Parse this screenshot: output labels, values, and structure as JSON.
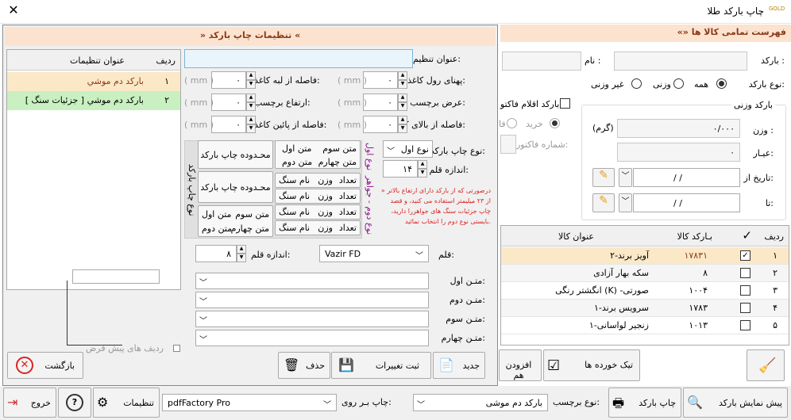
{
  "window": {
    "title": "چاپ بارکد طلا",
    "close": "✕",
    "logo": "GOLD"
  },
  "main": {
    "header": "«» فهرست تمامی کالا ها",
    "barcode_label": "بارکد :",
    "name_label": "نام :",
    "type_label": "نوع بارکد:",
    "types": [
      "همه",
      "وزنی",
      "غیر وزنی"
    ],
    "weight_group": "بارکد وزنی",
    "weight_label": "وزن :",
    "weight_value": "۰/۰۰۰",
    "weight_unit": "(گرم)",
    "ayar_label": "عیـار:",
    "ayar_value": "۰",
    "date_from": "تاریخ از:",
    "date_to": "تا:",
    "date_value": "/   /",
    "factor_check": "بارکد اقلام فاکتو",
    "factor_buy": "خرید",
    "factor_no": "شماره فاکتور:",
    "factor_fa": "فا",
    "grid_headers": {
      "row": "ردیف",
      "check": "✓",
      "barcode": "بـارکد کالا",
      "title": "عنوان کالا"
    },
    "rows": [
      {
        "n": "۱",
        "barcode": "۱۷۸۳۱",
        "title": "آویز برند-۲",
        "checked": "✓"
      },
      {
        "n": "۲",
        "barcode": "۸",
        "title": "سکه بهار آزادی",
        "checked": ""
      },
      {
        "n": "۳",
        "barcode": "۱۰۰۴",
        "title": "انگشتر رنگی (K) -صورتی",
        "checked": ""
      },
      {
        "n": "۴",
        "barcode": "۱۷۸۳",
        "title": "سرویس برند-۱",
        "checked": ""
      },
      {
        "n": "۵",
        "barcode": "۱۰۱۳",
        "title": "زنجیر لواسانی-۱",
        "checked": ""
      }
    ],
    "btn_damaged": "تیک خورده ها",
    "btn_add": "افزودن هم"
  },
  "dialog": {
    "title": "»  تنظیمات چاپ بارکد  «",
    "list_headers": {
      "row": "ردیف",
      "title": "عنوان تنظیمات"
    },
    "list": [
      {
        "n": "۱",
        "title": "بارکد دم موشي"
      },
      {
        "n": "۲",
        "title": "بارکد دم موشي [ جزئیات سنگ ]"
      }
    ],
    "setting_title_label": "عنوان تنظیم:",
    "roll_width": "پهنای رول کاغذ:",
    "label_width": "عرض برچسب:",
    "top_margin": "فاصله از بالای کاغذ:",
    "edge_margin": "فاصله از لبه کاغذ:",
    "label_height": "ارتفاع برچسب:",
    "bottom_margin": "فاصله از پائین کاغذ:",
    "zero": "۰",
    "mm": "( mm )",
    "print_type_label": "نوع چاپ بارکد:",
    "print_type_value": "نوع اول",
    "pen_size_label": "اندازه قلم بارکد:",
    "pen_size_value": "۱۴",
    "note": "» درصورتی که از بارکد دارای ارتفاع بالاتر از ۲۳ میلیمتر استفاده می کنید، و قصد چاپ جزئیات سنگ های جواهررا دارید، بایستی نوع دوم را انتخاب نمائید.",
    "type1_v": "نوع اول",
    "type2_v": "نوع دوم - جواهر",
    "print_type_v": "نوع چاپ بارکد",
    "txt3": "متن سوم",
    "txt1": "متن اول",
    "txt4": "متن چهارم",
    "txt2": "متن دوم",
    "area": "محـدوده چاپ بارکد",
    "count": "تعداد",
    "weight": "وزن",
    "stone": "نام سنگ",
    "font_label": "قلم:",
    "font_value": "Vazir FD",
    "font_size_label": "اندازه قلم:",
    "font_size_value": "۸",
    "text1_label": "متـن اول:",
    "text2_label": "متـن دوم:",
    "text3_label": "متـن سوم:",
    "text4_label": "متـن چهارم:",
    "default_rows": "ردیف های پیش فرض",
    "btn_back": "بازگشت",
    "btn_delete": "حذف",
    "btn_save": "ثبت تغییرات",
    "btn_new": "جدید"
  },
  "bottom": {
    "preview": "پیش نمایش بارکد",
    "print": "چاپ بارکد",
    "label_type": "نوع برچسب:",
    "label_value": "بارکد دم موشی",
    "print_on": "چاپ بـر روی:",
    "printer": "pdfFactory Pro",
    "settings": "تنظیمات",
    "help": "?",
    "exit": "خروج"
  },
  "colors": {
    "accent": "#fbe3cf",
    "selected_row": "#fbe8c7",
    "green_row": "#c8f0c0"
  }
}
